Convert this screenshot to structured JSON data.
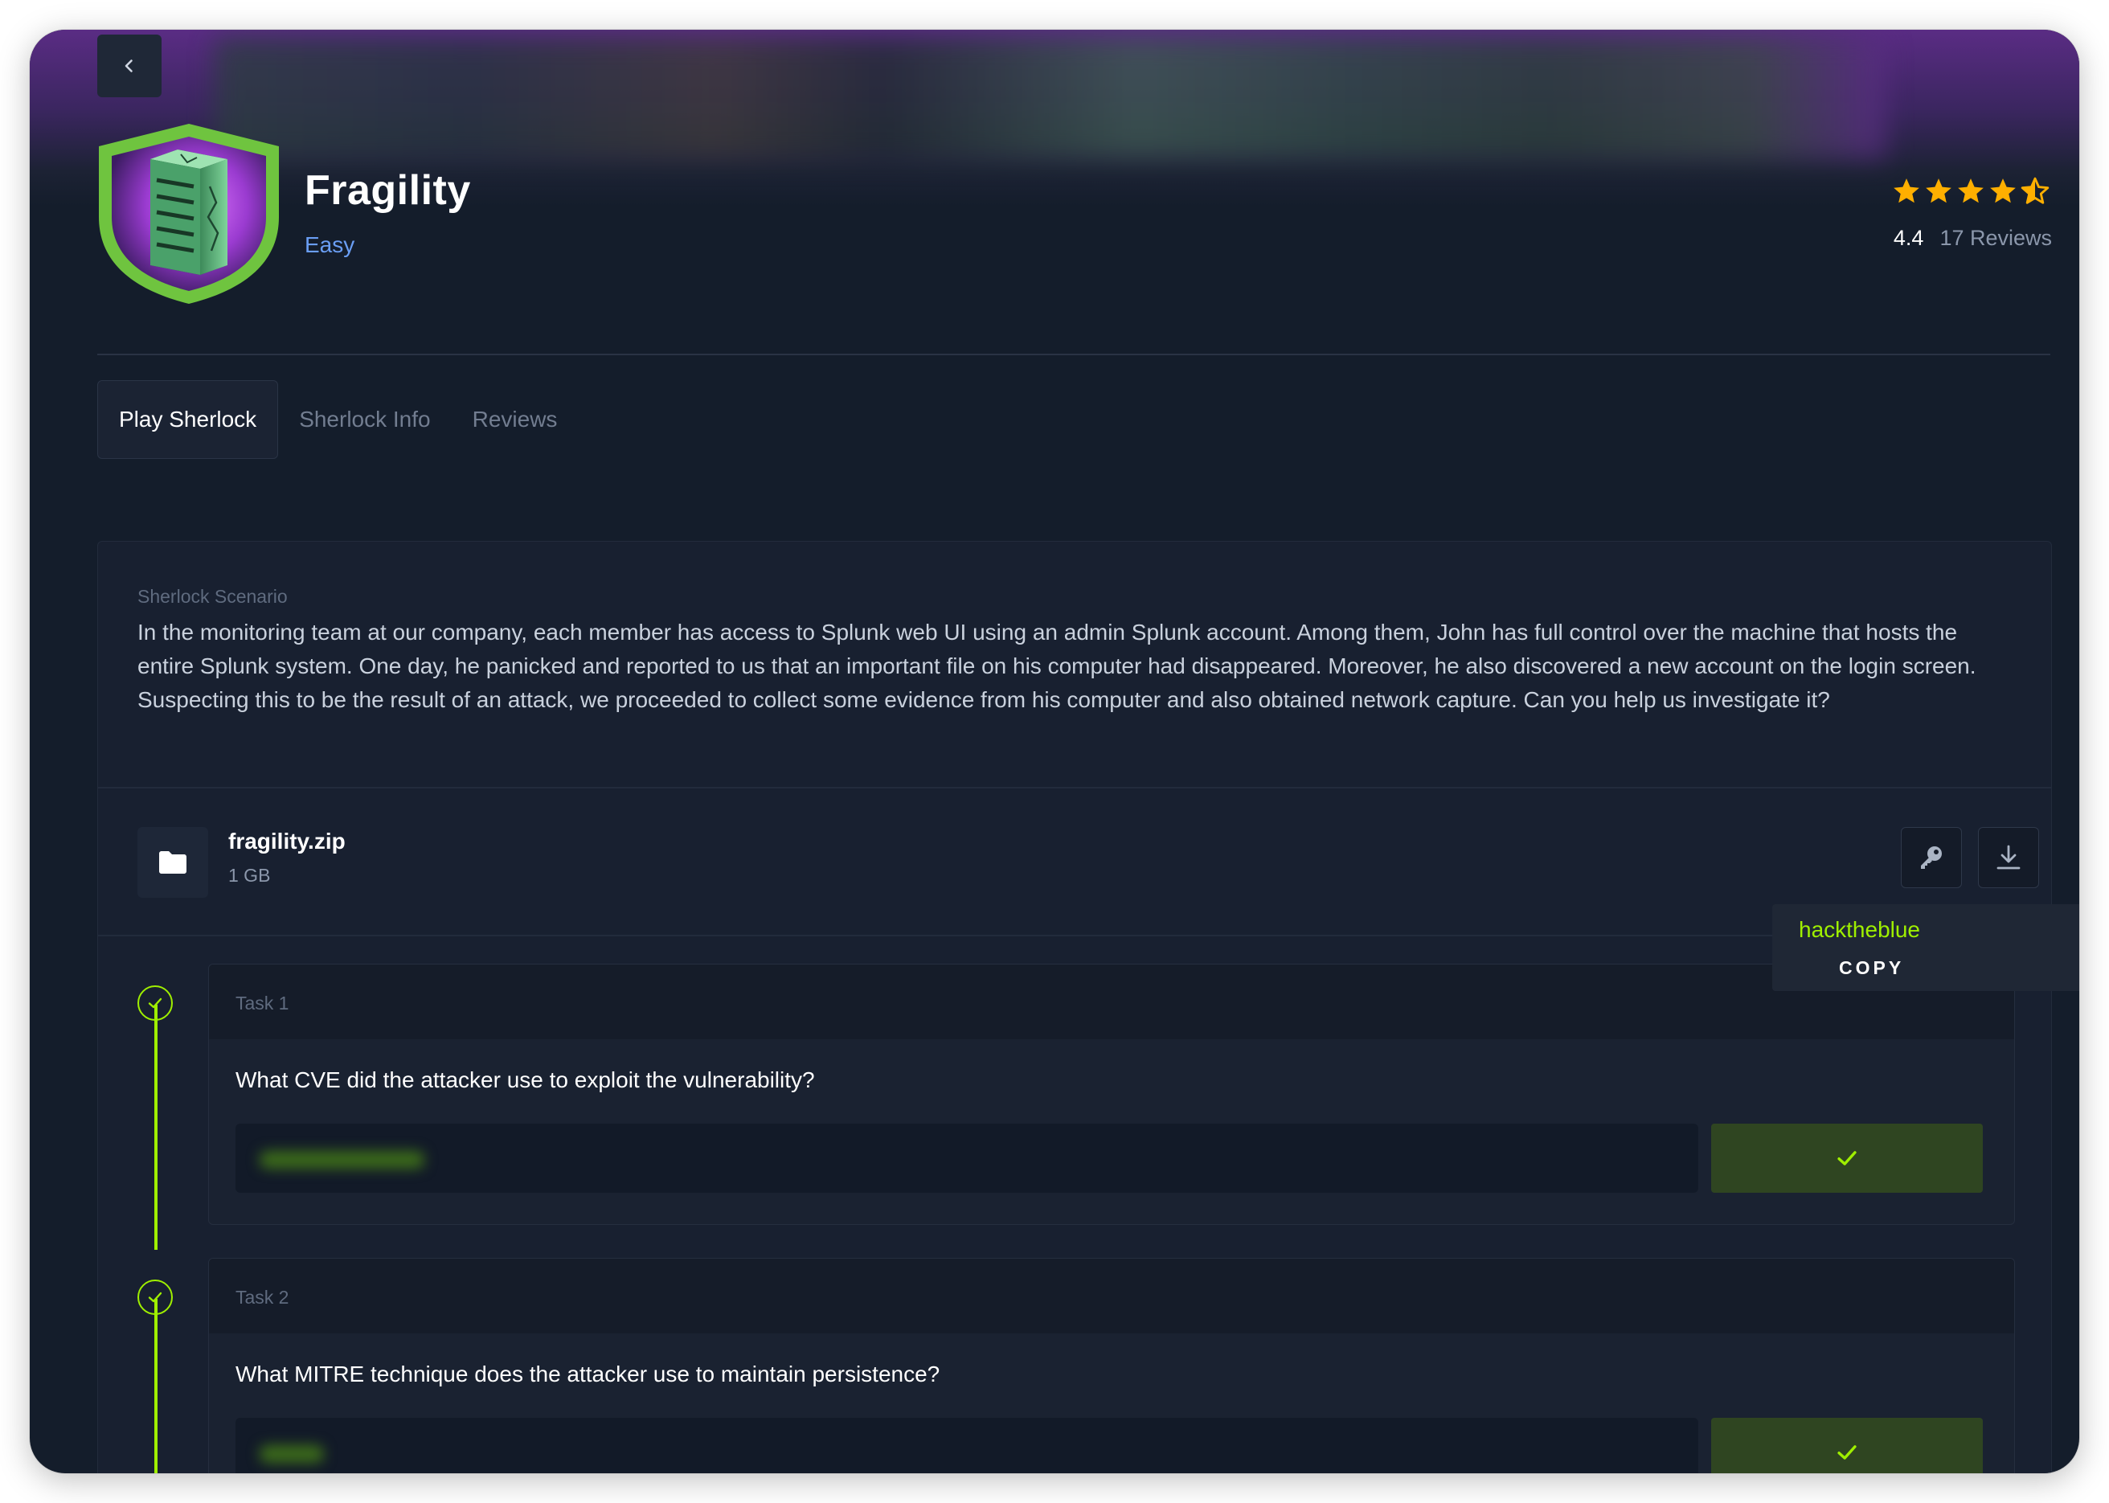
{
  "sherlock": {
    "title": "Fragility",
    "difficulty": "Easy",
    "rating": "4.4",
    "stars": 4.4,
    "reviews": "17 Reviews"
  },
  "tabs": [
    {
      "label": "Play Sherlock",
      "active": true
    },
    {
      "label": "Sherlock Info",
      "active": false
    },
    {
      "label": "Reviews",
      "active": false
    }
  ],
  "scenario": {
    "label": "Sherlock Scenario",
    "text": "In the monitoring team at our company, each member has access to Splunk web UI using an admin Splunk account. Among them, John has full control over the machine that hosts the entire Splunk system. One day, he panicked and reported to us that an important file on his computer had disappeared. Moreover, he also discovered a new account on the login screen. Suspecting this to be the result of an attack, we proceeded to collect some evidence from his computer and also obtained network capture. Can you help us investigate it?"
  },
  "file": {
    "name": "fragility.zip",
    "size": "1 GB"
  },
  "password_popover": {
    "password": "hacktheblue",
    "copy_label": "COPY"
  },
  "tasks": [
    {
      "label": "Task 1",
      "question": "What CVE did the attacker use to exploit the vulnerability?",
      "completed": true
    },
    {
      "label": "Task 2",
      "question": "What MITRE technique does the attacker use to maintain persistence?",
      "completed": true
    }
  ],
  "icons": {
    "back": "chevron-left-icon",
    "file": "folder-icon",
    "password": "key-icon",
    "download": "download-icon",
    "task_done": "check-circle-icon",
    "submit": "check-icon"
  },
  "colors": {
    "background": "#141d2b",
    "accent_green": "#9fef00",
    "difficulty_blue": "#6a9ef4",
    "star_orange": "#ffaf00",
    "submit_bg": "#2f4521"
  }
}
